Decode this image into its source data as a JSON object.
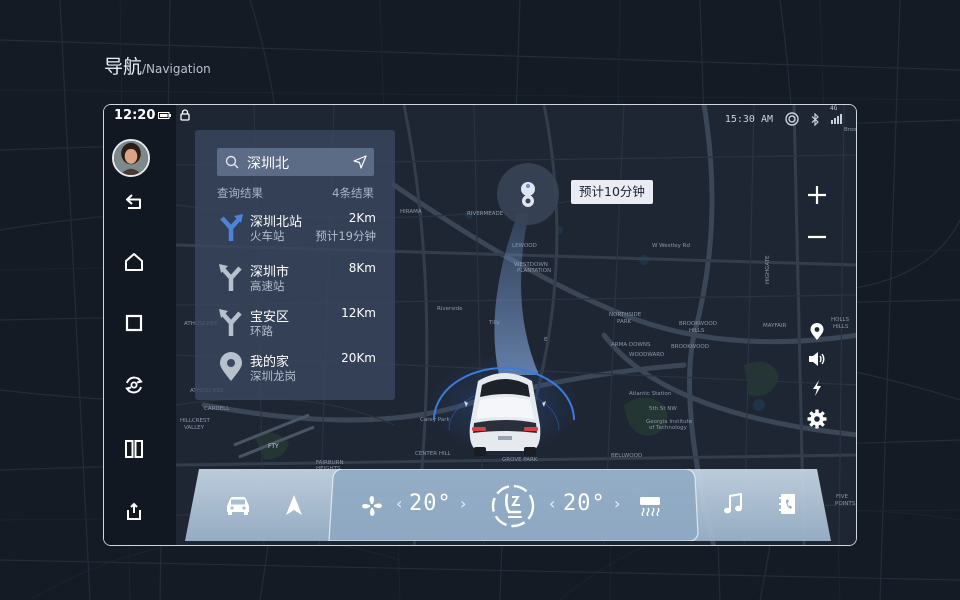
{
  "heading": {
    "title_zh": "导航",
    "title_en": "/Navigation"
  },
  "status": {
    "time": "12:20",
    "clock_right": "15:30 AM",
    "network": "4G"
  },
  "sidebar": {
    "items": [
      {
        "name": "back"
      },
      {
        "name": "home"
      },
      {
        "name": "recent"
      },
      {
        "name": "rotate-camera"
      },
      {
        "name": "split-view"
      },
      {
        "name": "exit"
      }
    ]
  },
  "search": {
    "query": "深圳北",
    "result_label": "查询结果",
    "result_count": "4条结果",
    "results": [
      {
        "name": "深圳北站",
        "sub": "火车站",
        "dist": "2Km",
        "eta": "预计19分钟",
        "icon": "fork-arrow-icon",
        "active": true
      },
      {
        "name": "深圳市",
        "sub": "高速站",
        "dist": "8Km",
        "eta": "",
        "icon": "fork-arrow-icon",
        "active": false
      },
      {
        "name": "宝安区",
        "sub": "环路",
        "dist": "12Km",
        "eta": "",
        "icon": "fork-arrow-icon",
        "active": false
      },
      {
        "name": "我的家",
        "sub": "深圳龙岗",
        "dist": "20Km",
        "eta": "",
        "icon": "location-pin-icon",
        "active": false
      }
    ]
  },
  "map": {
    "eta_badge": "预计10分钟",
    "labels": [
      "HIRAMA",
      "RIVERMEADE",
      "LEWOOD",
      "WESTDOWN PLANTATION",
      "W Westley Rd",
      "HIGHGATE",
      "NORTHSIDE PARK",
      "ARMA DOWNS",
      "BROOKWOOD HILLS",
      "MAYFAIR",
      "HOLLS HILLS",
      "BROOKWOOD",
      "WOODWARD",
      "Riverside",
      "Tilly",
      "Carey Park",
      "CENTER HILL",
      "GROVE PARK",
      "FAIRBURN HEIGHTS",
      "FTY",
      "BELLWOOD",
      "HILLCREST VALLEY",
      "CARDELL",
      "ATHOSCHEE",
      "5th St NW",
      "Georgia Institute of Technology",
      "Atlantic Station",
      "PEACHTREE HILLS",
      "LENOX",
      "FIVE POINTS",
      "Brook"
    ]
  },
  "map_controls": [
    "zoom-in",
    "zoom-out",
    "location",
    "volume",
    "charging",
    "settings"
  ],
  "climate": {
    "left_temp": "20°",
    "right_temp": "20°",
    "colors": {
      "bar": "#c6d7e6",
      "center": "#aec3d9"
    }
  },
  "colors": {
    "accent_blue": "#4a7fd8",
    "panel": "#3a4860",
    "background": "#141a24"
  }
}
